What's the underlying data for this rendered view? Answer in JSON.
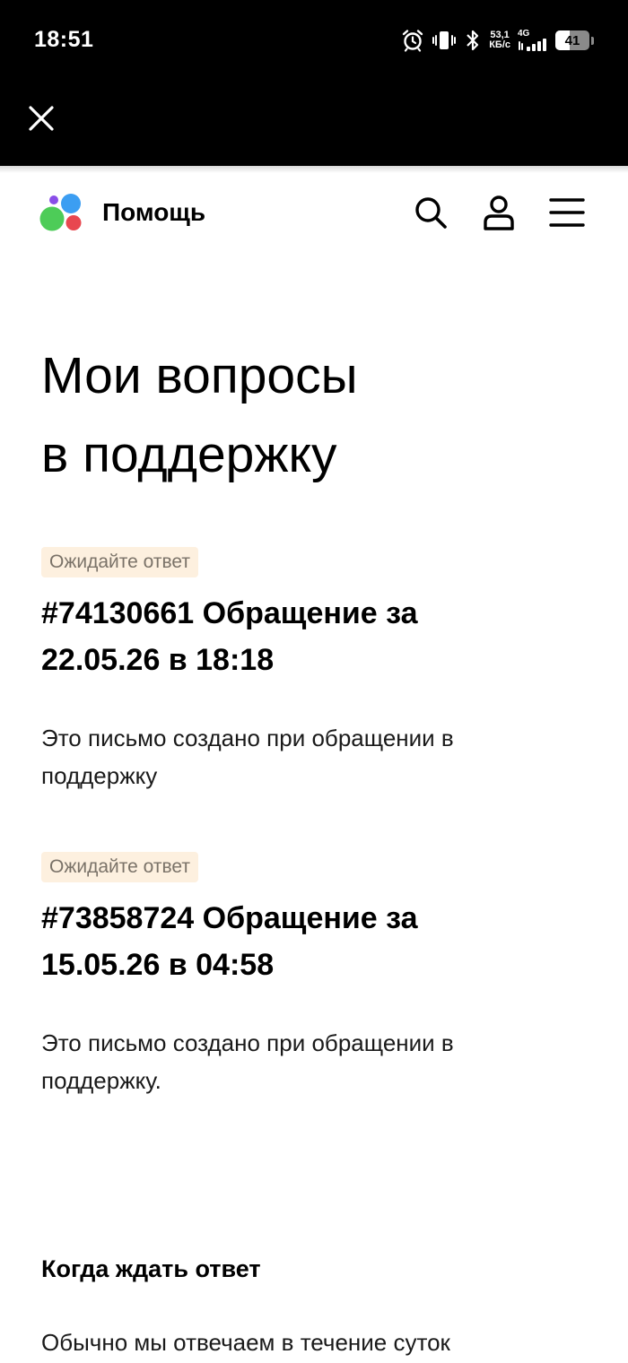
{
  "status_bar": {
    "time": "18:51",
    "net_speed_value": "53,1",
    "net_speed_unit": "КБ/с",
    "network_type": "4G",
    "battery_level": "41",
    "battery_fraction": 0.41
  },
  "app_bar": {
    "close_icon": "close-icon"
  },
  "header": {
    "title": "Помощь",
    "icons": [
      "search-icon",
      "user-icon",
      "menu-icon"
    ],
    "logo_colors": [
      "#8a4ee8",
      "#3c9ef2",
      "#4dcc58",
      "#e8474f"
    ]
  },
  "page": {
    "title_line1": "Мои вопросы",
    "title_line2": "в поддержку"
  },
  "tickets": [
    {
      "status": "Ожидайте ответ",
      "title_line1": "#74130661 Обращение за",
      "title_line2": "22.05.26 в 18:18",
      "description_line1": "Это письмо создано при обращении в",
      "description_line2": "поддержку"
    },
    {
      "status": "Ожидайте ответ",
      "title_line1": "#73858724 Обращение за",
      "title_line2": "15.05.26 в 04:58",
      "description_line1": "Это письмо создано при обращении в",
      "description_line2": "поддержку."
    }
  ],
  "info": {
    "title": "Когда ждать ответ",
    "text": "Обычно мы отвечаем в течение суток"
  },
  "colors": {
    "status_badge_bg": "#fdf0df",
    "status_badge_text": "#7a7268",
    "top_bar": "#000000"
  }
}
